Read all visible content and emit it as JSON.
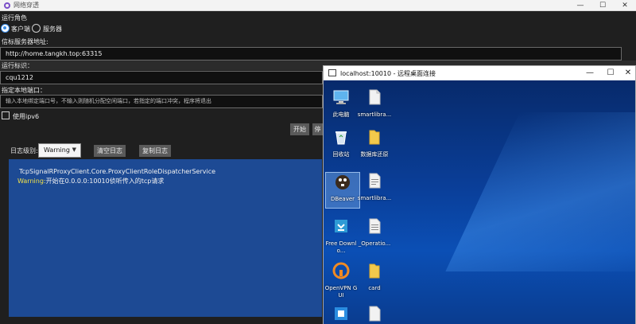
{
  "app": {
    "title": "网络穿透",
    "window_controls": {
      "minimize": "—",
      "maximize": "☐",
      "close": "✕"
    },
    "role_label": "运行角色",
    "roles": [
      {
        "label": "客户端",
        "selected": true
      },
      {
        "label": "服务器",
        "selected": false
      }
    ],
    "signal_server_label": "信标服务器地址:",
    "signal_server_value": "http://home.tangkh.top:63315",
    "run_id_label": "运行标识：",
    "run_id_value": "cqu1212",
    "local_port_label": "指定本地端口：",
    "local_port_placeholder": "输入本地绑定端口号，不输入则随机分配空闲端口，若指定的端口冲突，程序将退出",
    "ipv6_label": "使用ipv6",
    "start_button": "开始",
    "stop_button_partial": "停",
    "log_level_label": "日志级别:",
    "log_level_value": "Warning",
    "clear_log_button": "清空日志",
    "copy_log_button": "复制日志",
    "log_lines": [
      {
        "prefix": "",
        "text": "TcpSignalRProxyClient.Core.ProxyClientRoleDispatcherService"
      },
      {
        "prefix": "Warning:",
        "text": "开始在0.0.0.0:10010侦听传入的tcp请求"
      }
    ]
  },
  "remote": {
    "title": "localhost:10010 - 远程桌面连接",
    "window_controls": {
      "minimize": "—",
      "maximize": "☐",
      "close": "✕"
    },
    "icons": [
      {
        "caption": "此电脑",
        "icon": "computer-icon"
      },
      {
        "caption": "smartlibra...",
        "icon": "file-icon"
      },
      {
        "caption": "回收站",
        "icon": "recycle-bin-icon"
      },
      {
        "caption": "数据库还原",
        "icon": "folder-icon"
      },
      {
        "caption": "DBeaver",
        "icon": "dbeaver-icon"
      },
      {
        "caption": "smartlibra...",
        "icon": "file-icon"
      },
      {
        "caption": "Free Downlo...",
        "icon": "download-icon"
      },
      {
        "caption": "_Operatio...",
        "icon": "document-icon"
      },
      {
        "caption": "OpenVPN GUI",
        "icon": "openvpn-icon"
      },
      {
        "caption": "card",
        "icon": "folder-icon"
      }
    ]
  },
  "colors": {
    "log_background": "#1d4a94",
    "warning_text": "#f0e04a",
    "accent": "#3b8eea"
  }
}
